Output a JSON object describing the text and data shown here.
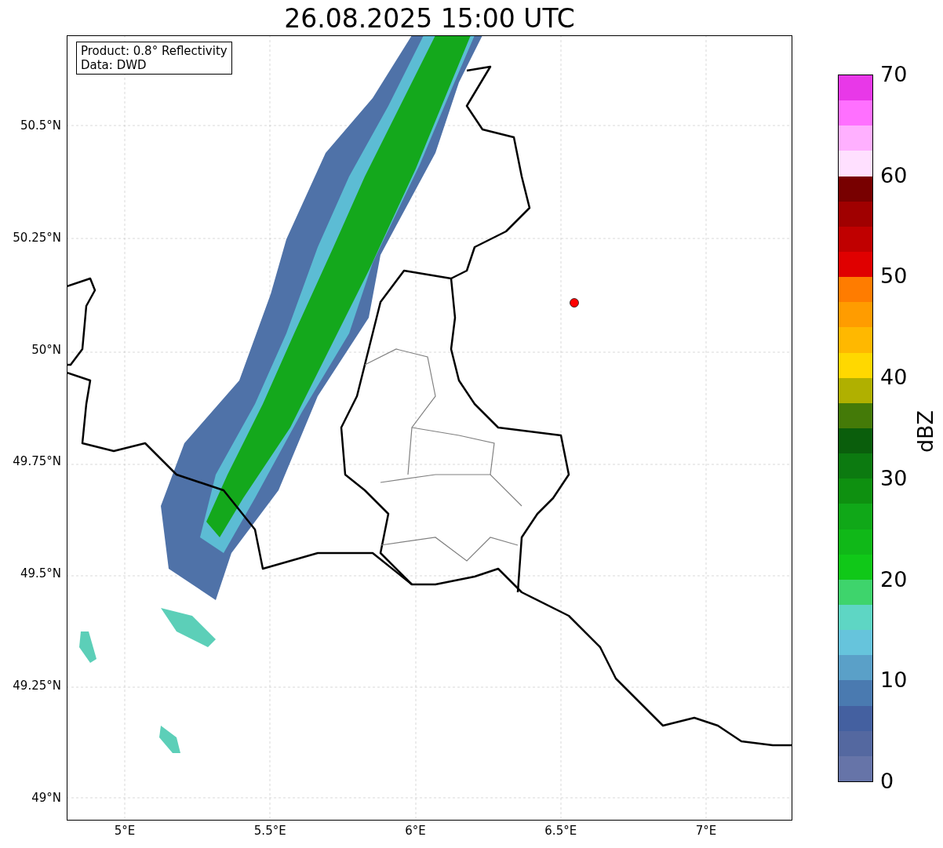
{
  "title": "26.08.2025 15:00 UTC",
  "info_box": [
    "Product: 0.8° Reflectivity",
    "Data: DWD"
  ],
  "map": {
    "y_ticks": [
      "50.5°N",
      "50.25°N",
      "50°N",
      "49.75°N",
      "49.5°N",
      "49.25°N",
      "49°N"
    ],
    "x_ticks": [
      "5°E",
      "5.5°E",
      "6°E",
      "6.5°E",
      "7°E"
    ],
    "marker": {
      "color": "#ff0000"
    }
  },
  "colorbar": {
    "label": "dBZ",
    "ticks": [
      "70",
      "60",
      "50",
      "40",
      "30",
      "20",
      "10",
      "0"
    ],
    "segments": [
      {
        "color": "#e838e8"
      },
      {
        "color": "#ff70ff"
      },
      {
        "color": "#ffb0ff"
      },
      {
        "color": "#ffe0ff"
      },
      {
        "color": "#780000"
      },
      {
        "color": "#a00000"
      },
      {
        "color": "#c00000"
      },
      {
        "color": "#e00000"
      },
      {
        "color": "#ff7c00"
      },
      {
        "color": "#ff9c00"
      },
      {
        "color": "#ffb800"
      },
      {
        "color": "#ffd800"
      },
      {
        "color": "#b0b000"
      },
      {
        "color": "#447a08"
      },
      {
        "color": "#0a5e0c"
      },
      {
        "color": "#0c7a10"
      },
      {
        "color": "#0e9010"
      },
      {
        "color": "#10a818"
      },
      {
        "color": "#10b818"
      },
      {
        "color": "#10c818"
      },
      {
        "color": "#3ed46c"
      },
      {
        "color": "#5ed6c4"
      },
      {
        "color": "#66c4dc"
      },
      {
        "color": "#5aa0c8"
      },
      {
        "color": "#4a7ab0"
      },
      {
        "color": "#4460a0"
      },
      {
        "color": "#5468a0"
      },
      {
        "color": "#6674a8"
      }
    ]
  }
}
